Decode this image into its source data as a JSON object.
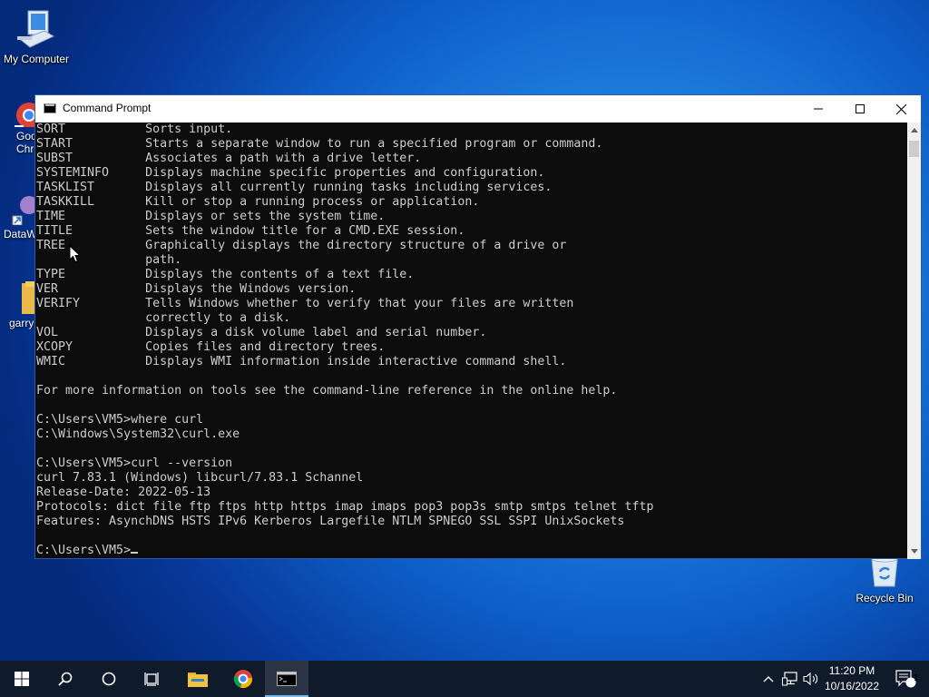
{
  "desktop": {
    "icons": {
      "my_computer": "My Computer",
      "recycle_bin": "Recycle Bin",
      "partial_1": "Goo Chr",
      "partial_2": "DataW",
      "partial_3": "garry"
    }
  },
  "window": {
    "title": "Command Prompt",
    "minimize": "minimize-icon",
    "maximize": "maximize-icon",
    "close": "close-icon"
  },
  "terminal": {
    "lines": [
      "SORT           Sorts input.",
      "START          Starts a separate window to run a specified program or command.",
      "SUBST          Associates a path with a drive letter.",
      "SYSTEMINFO     Displays machine specific properties and configuration.",
      "TASKLIST       Displays all currently running tasks including services.",
      "TASKKILL       Kill or stop a running process or application.",
      "TIME           Displays or sets the system time.",
      "TITLE          Sets the window title for a CMD.EXE session.",
      "TREE           Graphically displays the directory structure of a drive or",
      "               path.",
      "TYPE           Displays the contents of a text file.",
      "VER            Displays the Windows version.",
      "VERIFY         Tells Windows whether to verify that your files are written",
      "               correctly to a disk.",
      "VOL            Displays a disk volume label and serial number.",
      "XCOPY          Copies files and directory trees.",
      "WMIC           Displays WMI information inside interactive command shell.",
      "",
      "For more information on tools see the command-line reference in the online help.",
      "",
      "C:\\Users\\VM5>where curl",
      "C:\\Windows\\System32\\curl.exe",
      "",
      "C:\\Users\\VM5>curl --version",
      "curl 7.83.1 (Windows) libcurl/7.83.1 Schannel",
      "Release-Date: 2022-05-13",
      "Protocols: dict file ftp ftps http https imap imaps pop3 pop3s smtp smtps telnet tftp",
      "Features: AsynchDNS HSTS IPv6 Kerberos Largefile NTLM SPNEGO SSL SSPI UnixSockets",
      ""
    ],
    "prompt": "C:\\Users\\VM5>"
  },
  "taskbar": {
    "items": [
      "start-icon",
      "search-icon",
      "cortana-icon",
      "task-view-icon",
      "file-explorer-icon",
      "chrome-icon",
      "command-prompt-icon"
    ],
    "tray_icons": [
      "chevron-up-icon",
      "network-icon",
      "volume-icon"
    ],
    "time": "11:20 PM",
    "date": "10/16/2022",
    "notification_count": "1"
  },
  "colors": {
    "terminal_bg": "#0c0c0c",
    "terminal_fg": "#cccccc",
    "taskbar_bg": "#0f1a2b",
    "accent": "#76b9ed"
  }
}
